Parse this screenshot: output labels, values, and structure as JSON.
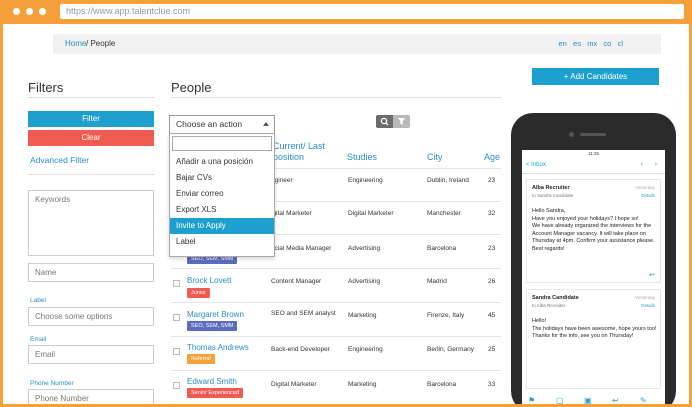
{
  "browser": {
    "url": "https://www.app.talentclue.com"
  },
  "breadcrumb": {
    "home": "Home",
    "current": "/ People"
  },
  "languages": [
    "en",
    "es",
    "mx",
    "co",
    "cl"
  ],
  "filters": {
    "title": "Filters",
    "filter_button": "Filter",
    "clear_button": "Clear",
    "advanced_link": "Advanced Filter",
    "keywords_placeholder": "Keywords",
    "name_placeholder": "Name",
    "label_label": "Label",
    "label_placeholder": "Choose some options",
    "email_label": "Email",
    "email_placeholder": "Email",
    "phone_label": "Phone Number",
    "phone_placeholder": "Phone Number"
  },
  "people": {
    "title": "People",
    "add_button": "+ Add Candidates",
    "action_select": "Choose an action",
    "action_menu": [
      "Añadir a una posición",
      "Bajar CVs",
      "Enviar correo",
      "Export XLS",
      "Invite to Apply",
      "Label"
    ],
    "action_menu_highlighted": "Invite to Apply",
    "columns": {
      "position": "Current/ Last position",
      "studies": "Studies",
      "city": "City",
      "age": "Age"
    },
    "rows": [
      {
        "name": "",
        "tag": "",
        "position": "ngineer",
        "studies": "Engineering",
        "city": "Dublin, Ireland",
        "age": "23"
      },
      {
        "name": "",
        "tag": "",
        "position": "igital Marketer",
        "studies": "Digital Marketer",
        "city": "Manchester",
        "age": "32"
      },
      {
        "name": "",
        "tag": "SEO, SEM, SMM",
        "position": "ocial Media Manager",
        "studies": "Advertising",
        "city": "Barcelona",
        "age": "23"
      },
      {
        "name": "Brock Lovett",
        "tag": "Junior",
        "position": "Content Manager",
        "studies": "Advertising",
        "city": "Madrid",
        "age": "26"
      },
      {
        "name": "Margaret Brown",
        "tag": "SEO, SEM, SMM",
        "position": "SEO and SEM analyst",
        "studies": "Marketing",
        "city": "Firenze, Italy",
        "age": "45"
      },
      {
        "name": "Thomas Andrews",
        "tag": "Referral",
        "position": "Back-end Developer",
        "studies": "Engineering",
        "city": "Berlin, Germany",
        "age": "25"
      },
      {
        "name": "Edward Smith",
        "tag": "Senior Experienced",
        "position": "Digital Marketer",
        "studies": "Marketing",
        "city": "Barcelona",
        "age": "33"
      }
    ]
  },
  "phone": {
    "time": "11:25",
    "inbox": "< Inbox",
    "mails": [
      {
        "from": "Alba Recruiter",
        "to": "to Sandra Candidate",
        "date": "Yesterday",
        "details": "Details",
        "body": "Hello Sandra,\nHave you enjoyed your holidays? I hope so!\nWe have already organized the interviews for the Account Manager vacancy. It will take place on Thursday at 4pm. Confirm your assistance please. Best regards!"
      },
      {
        "from": "Sandra Candidate",
        "to": "to Alba Recruiter",
        "date": "Yesterday",
        "details": "Details",
        "body": "Hello!\nThe holidays have been awesome, hope yours too! Thanks for the info, see you on Thursday!"
      }
    ]
  },
  "colors": {
    "accent": "#1d9fd0",
    "danger": "#f05b4f",
    "frame": "#f5a03a",
    "link": "#2b8cc4"
  },
  "tag_colors": {
    "SEO, SEM, SMM": "#5b6bbf",
    "Junior": "#f05b4f",
    "Referral": "#f5a03a",
    "Senior Experienced": "#f05b4f"
  }
}
